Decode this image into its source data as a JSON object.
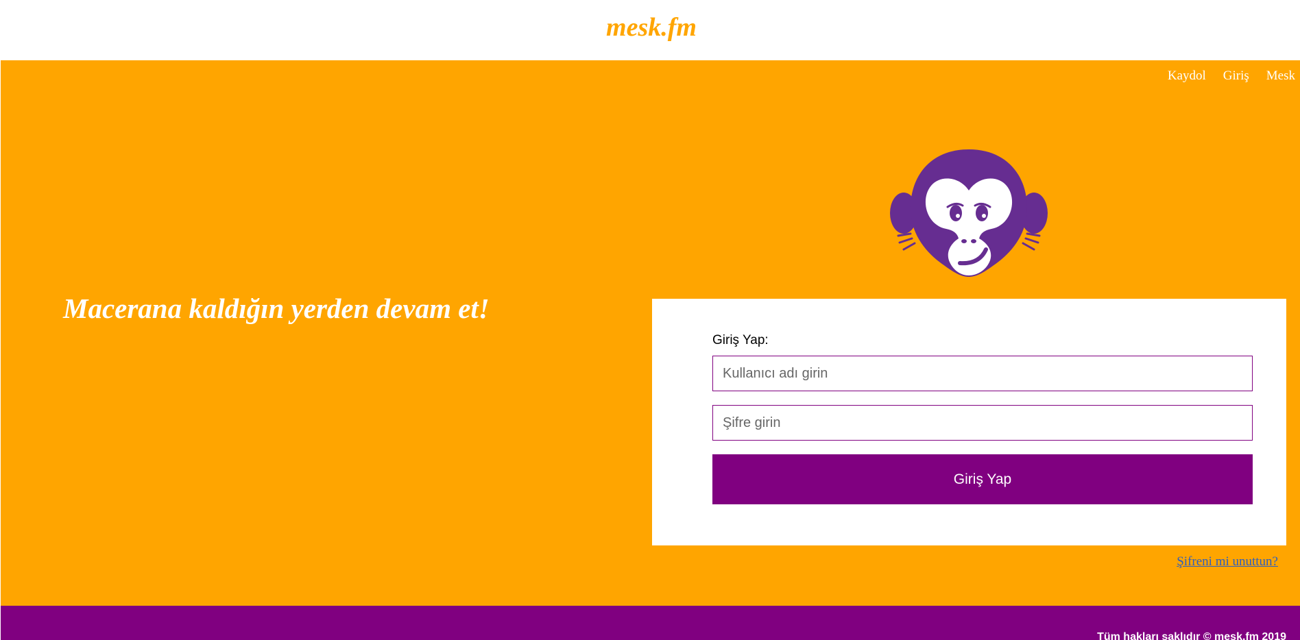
{
  "header": {
    "logo": "mesk.fm"
  },
  "nav": {
    "items": [
      "Kaydol",
      "Giriş",
      "Mesk"
    ]
  },
  "hero": {
    "tagline": "Macerana kaldığın yerden devam et!",
    "mascot_icon": "monkey-head-icon"
  },
  "login": {
    "label": "Giriş Yap:",
    "username_placeholder": "Kullanıcı adı girin",
    "username_value": "",
    "password_placeholder": "Şifre girin",
    "password_value": "",
    "submit_label": "Giriş Yap",
    "forgot_link": "Şifreni mi unuttun?"
  },
  "footer": {
    "copyright": "Tüm hakları saklıdır © mesk.fm 2019"
  },
  "colors": {
    "brand_orange": "#ffa500",
    "brand_purple": "#800080",
    "mascot_purple": "#662d91",
    "link_blue": "#2d5fbf"
  }
}
